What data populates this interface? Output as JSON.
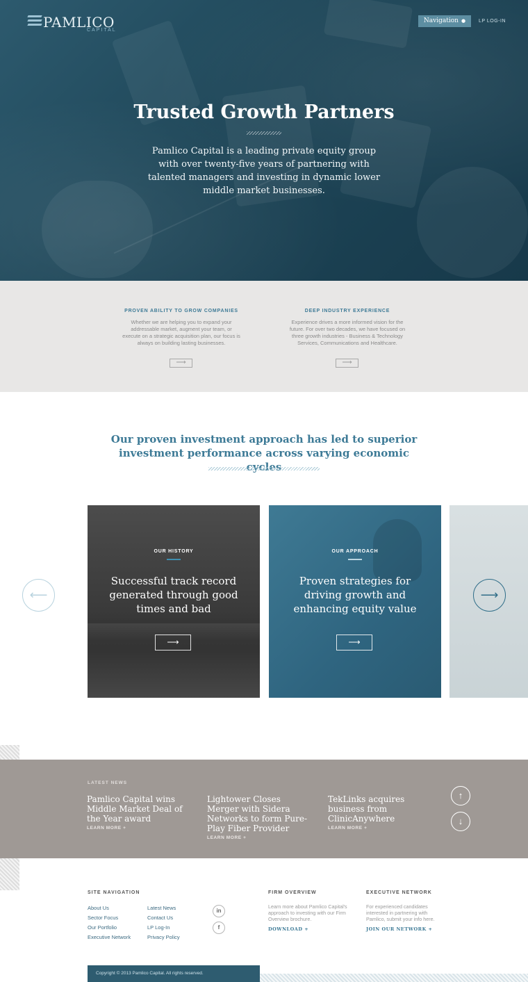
{
  "header": {
    "logo_name": "PAMLICO",
    "logo_sub": "CAPITAL",
    "nav_button": "Navigation",
    "lp_login": "LP LOG-IN"
  },
  "hero": {
    "title": "Trusted Growth Partners",
    "text": "Pamlico Capital is a leading private equity group with over twenty-five years of partnering with talented managers and investing in dynamic lower middle market businesses."
  },
  "features": [
    {
      "title": "PROVEN ABILITY TO GROW COMPANIES",
      "text": "Whether we are helping you to expand your addressable market, augment your team, or execute on a strategic acquisition plan, our focus is always on building lasting businesses.",
      "arrow": "⟶"
    },
    {
      "title": "DEEP INDUSTRY EXPERIENCE",
      "text": "Experience drives a more informed vision for the future. For over two decades, we have focused on three growth industries - Business & Technology Services, Communications and Healthcare.",
      "arrow": "⟶"
    }
  ],
  "approach": {
    "title": "Our proven investment approach has led to superior investment performance across varying economic cycles"
  },
  "cards": [
    {
      "eyebrow": "OUR HISTORY",
      "title": "Successful track record generated through good times and bad",
      "arrow": "⟶"
    },
    {
      "eyebrow": "OUR APPROACH",
      "title": "Proven strategies for driving growth and enhancing equity value",
      "arrow": "⟶"
    }
  ],
  "carousel": {
    "prev": "⟵",
    "next": "⟶"
  },
  "news": {
    "label": "LATEST NEWS",
    "items": [
      {
        "headline": "Pamlico Capital wins Middle Market Deal of the Year award",
        "more": "LEARN MORE +"
      },
      {
        "headline": "Lightower Closes Merger with Sidera Networks to form Pure-Play Fiber Provider",
        "more": "LEARN MORE +"
      },
      {
        "headline": "TekLinks acquires business from ClinicAnywhere",
        "more": "LEARN MORE +"
      }
    ],
    "up": "↑",
    "down": "↓"
  },
  "footer": {
    "site_nav_title": "SITE NAVIGATION",
    "nav_col1": [
      "About Us",
      "Sector Focus",
      "Our Portfolio",
      "Executive Network"
    ],
    "nav_col2": [
      "Latest News",
      "Contact Us",
      "LP Log-In",
      "Privacy Policy"
    ],
    "linkedin": "in",
    "facebook": "f",
    "firm_title": "FIRM OVERVIEW",
    "firm_text": "Learn more about Pamlico Capital's approach to investing with our Firm Overview brochure.",
    "firm_cta": "DOWNLOAD +",
    "exec_title": "EXECUTIVE NETWORK",
    "exec_text": "For experienced candidates interested in partnering with Pamlico, submit your info here.",
    "exec_cta": "JOIN OUR NETWORK +",
    "copyright": "Copyright © 2013 Pamlico Capital. All rights reserved."
  }
}
